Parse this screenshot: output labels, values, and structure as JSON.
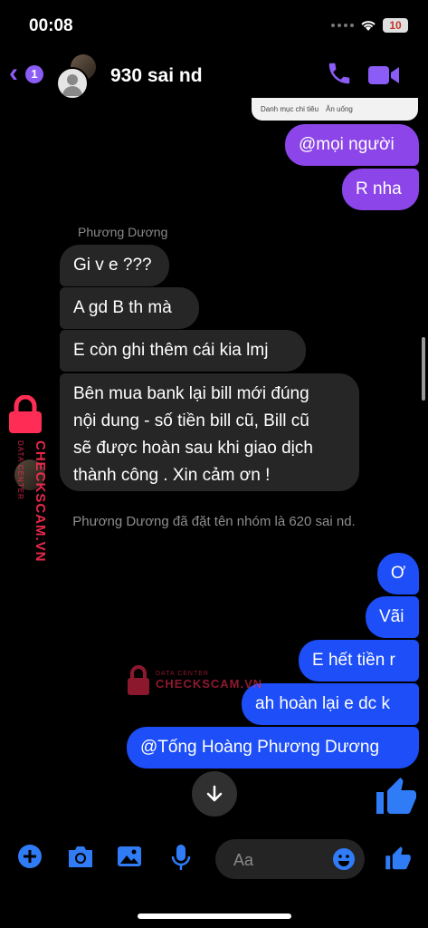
{
  "status": {
    "time": "00:08",
    "battery": "10"
  },
  "header": {
    "title": "930 sai nd",
    "unread_badge": "1"
  },
  "preview": {
    "item1": "Danh mục chi tiêu",
    "item2": "Ăn uống"
  },
  "messages": {
    "sent_top": [
      "@mọi người",
      "R nha"
    ],
    "sender_name": "Phương Dương",
    "received": [
      "Gi v e ???",
      "A gd B th mà",
      "E còn ghi thêm cái kia lmj",
      "Bên mua bank lại bill mới đúng",
      "nội dung - số tiền bill cũ, Bill cũ",
      "sẽ được hoàn sau khi giao dịch",
      "thành công . Xin cảm ơn !"
    ],
    "system": "Phương Dương đã đặt tên nhóm là 620 sai nd.",
    "sent_bottom": [
      "Ơ",
      "Vãi",
      "E hết tiền r",
      "ah hoàn lại e dc k",
      "@Tống Hoàng Phương Dương"
    ]
  },
  "watermark": {
    "brand": "CHECKSCAM.VN",
    "sub": "DATA CENTER"
  },
  "composer": {
    "placeholder": "Aa"
  },
  "colors": {
    "accent": "#8b5cf6",
    "sent_purple": "#8b45e8",
    "sent_blue": "#1d4ef7",
    "received": "#262626",
    "toolbar_icon": "#2f7cf6"
  }
}
